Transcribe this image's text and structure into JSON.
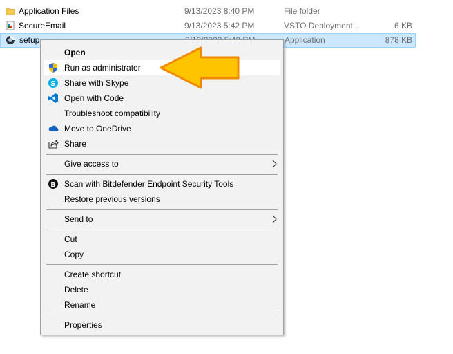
{
  "files": [
    {
      "name": "Application Files",
      "date": "9/13/2023 8:40 PM",
      "type": "File folder",
      "size": "",
      "icon": "folder-icon"
    },
    {
      "name": "SecureEmail",
      "date": "9/13/2023 5:42 PM",
      "type": "VSTO Deployment...",
      "size": "6 KB",
      "icon": "vsto-file-icon"
    },
    {
      "name": "setup",
      "date": "9/13/2023 5:42 PM",
      "type": "Application",
      "size": "878 KB",
      "icon": "setup-app-icon"
    }
  ],
  "context_menu": {
    "open": "Open",
    "run_as_admin": "Run as administrator",
    "share_with_skype": "Share with Skype",
    "open_with_code": "Open with Code",
    "troubleshoot": "Troubleshoot compatibility",
    "move_to_onedrive": "Move to OneDrive",
    "share": "Share",
    "give_access": "Give access to",
    "scan_bitdefender": "Scan with Bitdefender Endpoint Security Tools",
    "restore_versions": "Restore previous versions",
    "send_to": "Send to",
    "cut": "Cut",
    "copy": "Copy",
    "create_shortcut": "Create shortcut",
    "delete": "Delete",
    "rename": "Rename",
    "properties": "Properties"
  },
  "colors": {
    "selection": "#cce8ff",
    "menu_bg": "#f2f2f2",
    "arrow_fill": "#ffc400",
    "arrow_outline": "#f08a00"
  }
}
